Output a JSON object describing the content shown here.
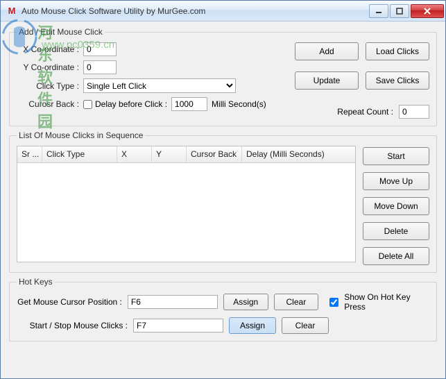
{
  "window": {
    "title": "Auto Mouse Click Software Utility by MurGee.com"
  },
  "watermark": {
    "text": "河东软件园",
    "url": "www.pc0359.cn"
  },
  "addEdit": {
    "legend": "Add / Edit Mouse Click",
    "x_label": "X Co-ordinate :",
    "x_value": "0",
    "y_label": "Y Co-ordinate :",
    "y_value": "0",
    "clicktype_label": "Click Type :",
    "clicktype_value": "Single Left Click",
    "cursorback_label": "Curosr Back :",
    "delay_label": "Delay before Click :",
    "delay_value": "1000",
    "delay_unit": "Milli Second(s)",
    "repeat_label": "Repeat Count :",
    "repeat_value": "0",
    "btn_add": "Add",
    "btn_load": "Load Clicks",
    "btn_update": "Update",
    "btn_save": "Save Clicks"
  },
  "sequence": {
    "legend": "List Of Mouse Clicks in Sequence",
    "cols": {
      "c0": "Sr ...",
      "c1": "Click Type",
      "c2": "X",
      "c3": "Y",
      "c4": "Cursor Back",
      "c5": "Delay (Milli Seconds)"
    },
    "btn_start": "Start",
    "btn_moveup": "Move Up",
    "btn_movedown": "Move Down",
    "btn_delete": "Delete",
    "btn_deleteall": "Delete All"
  },
  "hotkeys": {
    "legend": "Hot Keys",
    "getpos_label": "Get Mouse Cursor Position :",
    "getpos_value": "F6",
    "startstop_label": "Start / Stop Mouse Clicks :",
    "startstop_value": "F7",
    "btn_assign": "Assign",
    "btn_clear": "Clear",
    "show_label": "Show On Hot Key Press"
  }
}
